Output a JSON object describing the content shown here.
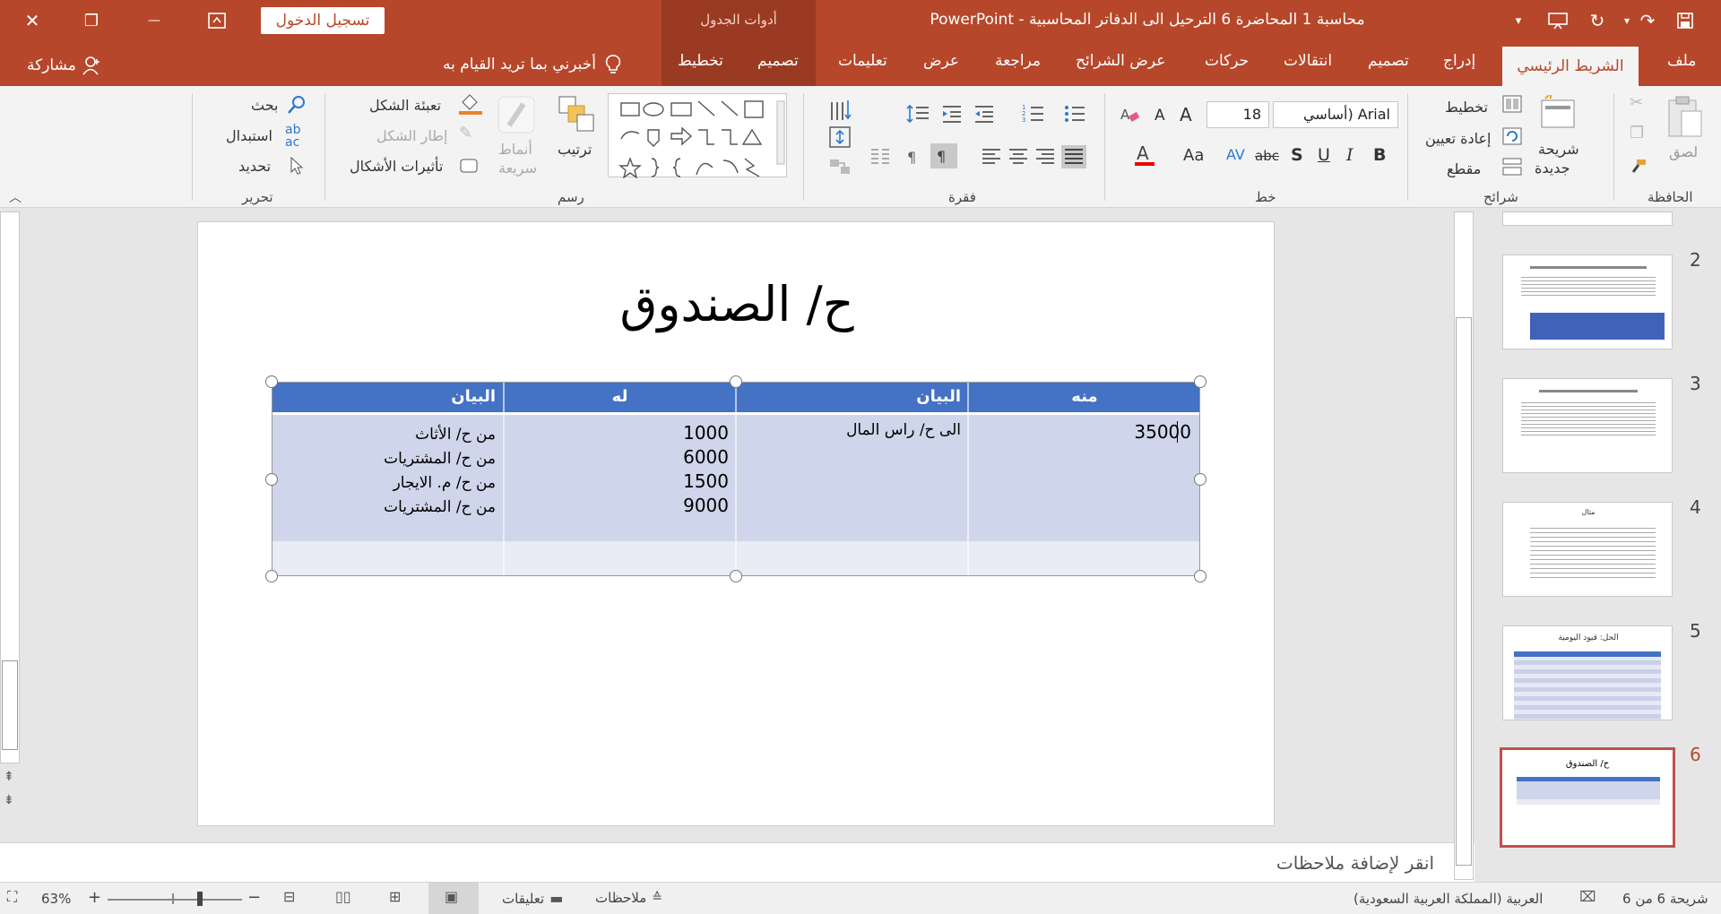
{
  "titlebar": {
    "title": "محاسبة 1 المحاضرة 6 الترحيل الى الدفاتر المحاسبية  -  PowerPoint",
    "table_tools": "أدوات الجدول",
    "signin": "تسجيل الدخول",
    "close": "✕",
    "restore": "❐",
    "minimize": "—"
  },
  "tabs": {
    "file": "ملف",
    "home": "الشريط الرئيسي",
    "insert": "إدراج",
    "design": "تصميم",
    "transitions": "انتقالات",
    "animations": "حركات",
    "slideshow": "عرض الشرائح",
    "review": "مراجعة",
    "view": "عرض",
    "help": "تعليمات",
    "table_design": "تصميم",
    "table_layout": "تخطيط",
    "tellme": "أخبرني بما تريد القيام به",
    "share": "مشاركة"
  },
  "ribbon": {
    "clipboard": {
      "paste": "لصق",
      "group": "الحافظة"
    },
    "slides": {
      "new_slide_1": "شريحة",
      "new_slide_2": "جديدة",
      "layout": "تخطيط",
      "reset": "إعادة تعيين",
      "section": "مقطع",
      "group": "شرائح"
    },
    "font": {
      "name": "Arial (أساسي",
      "size": "18",
      "group": "خط",
      "bold": "B",
      "italic": "I",
      "underline": "U",
      "shadow": "S",
      "strike": "abc",
      "spacing": "AV",
      "case": "Aa",
      "grow": "A",
      "shrink": "A"
    },
    "paragraph": {
      "group": "فقرة"
    },
    "drawing": {
      "arrange": "ترتيب",
      "quick_styles_1": "أنماط",
      "quick_styles_2": "سريعة",
      "shape_fill": "تعبئة الشكل",
      "shape_outline": "إطار الشكل",
      "shape_effects": "تأثيرات الأشكال",
      "group": "رسم"
    },
    "editing": {
      "find": "بحث",
      "replace": "استبدال",
      "select": "تحديد",
      "group": "تحرير"
    }
  },
  "slide": {
    "title": "ح/ الصندوق",
    "table": {
      "headers": [
        "منه",
        "البيان",
        "له",
        "البيان"
      ],
      "debit_amount": "35000",
      "debit_desc": "الى ح/ راس المال",
      "credit_amounts": [
        "1000",
        "6000",
        "1500",
        "9000"
      ],
      "credit_descs": [
        "من ح/ الأثاث",
        "من ح/ المشتريات",
        "من ح/ م. الايجار",
        "من ح/ المشتريات"
      ]
    }
  },
  "notes": {
    "placeholder": "انقر لإضافة ملاحظات"
  },
  "thumbnails": {
    "numbers": [
      "2",
      "3",
      "4",
      "5",
      "6"
    ],
    "t4_title": "مثال",
    "t5_title": "الحل: قيود اليومية",
    "t6_title": "ح/ الصندوق"
  },
  "statusbar": {
    "slide_count": "شريحة 6 من 6",
    "language": "العربية (المملكة العربية السعودية)",
    "notes": "ملاحظات",
    "comments": "تعليقات",
    "zoom": "63%"
  },
  "colors": {
    "accent": "#b7472a",
    "table_header": "#4472c4",
    "table_body": "#cfd5ea",
    "table_body_alt": "#e9ebf5"
  }
}
